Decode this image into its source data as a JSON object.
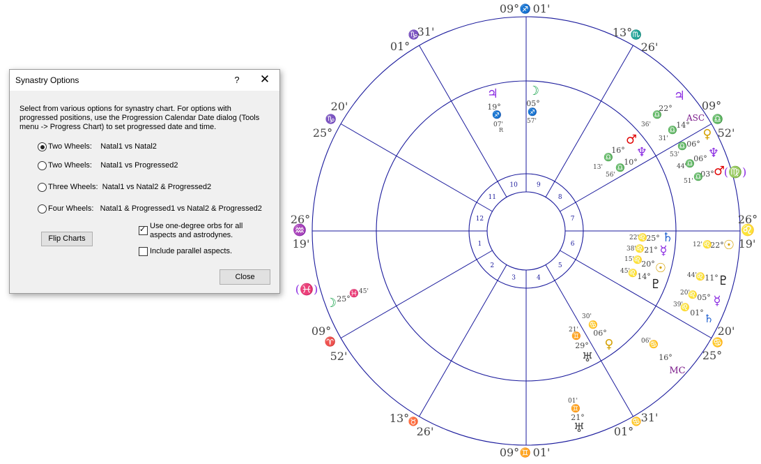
{
  "dialog": {
    "title": "Synastry Options",
    "help_label": "?",
    "close_glyph": "✕",
    "description": "Select from various options for synastry chart. For options with progressed positions, use the Progression Calendar Date dialog (Tools menu -> Progress Chart) to set progressed date and time.",
    "options": [
      {
        "label": "Two Wheels:    Natal1 vs Natal2",
        "selected": true
      },
      {
        "label": "Two Wheels:    Natal1 vs Progressed2",
        "selected": false
      },
      {
        "label": "Three Wheels:  Natal1 vs Natal2 & Progressed2",
        "selected": false
      },
      {
        "label": "Four Wheels:   Natal1 & Progressed1 vs Natal2 & Progressed2",
        "selected": false
      }
    ],
    "flip_label": "Flip Charts",
    "orbs_label": "Use one-degree orbs for all aspects and astrodynes.",
    "orbs_checked": true,
    "parallel_label": "Include parallel aspects.",
    "parallel_checked": false,
    "close_label": "Close"
  },
  "wheel": {
    "colors": {
      "lines": "#1a1a9c",
      "gray": "#444444",
      "purple": "#8a2be2",
      "gold": "#d4a000",
      "red": "#e00000",
      "green": "#16a34a",
      "blue": "#2060d0",
      "black": "#111111",
      "plum": "#7a1a8a"
    },
    "house_numbers": [
      "1",
      "2",
      "3",
      "4",
      "5",
      "6",
      "7",
      "8",
      "9",
      "10",
      "11",
      "12"
    ],
    "cusp_labels": [
      {
        "deg": "26°",
        "sign": "♒",
        "min": "19'",
        "sign_color": "blue"
      },
      {
        "deg": "09°",
        "sign": "♈",
        "min": "52'",
        "sign_color": "red"
      },
      {
        "deg": "13°",
        "sign": "♉",
        "min": "26'",
        "sign_color": "gold"
      },
      {
        "deg": "09°",
        "sign": "♊",
        "min": "01'",
        "sign_color": "purple"
      },
      {
        "deg": "01°",
        "sign": "♋",
        "min": "31'",
        "sign_color": "green"
      },
      {
        "deg": "20'",
        "sign": "♋",
        "min": "25°",
        "sign_color": "green"
      },
      {
        "deg": "26°",
        "sign": "♌",
        "min": "19'",
        "sign_color": "gold"
      },
      {
        "deg": "(♍)",
        "sign": "",
        "min": "",
        "sign_color": "purple"
      },
      {
        "deg": "09°",
        "sign": "♎",
        "min": "52'",
        "sign_color": "gold"
      },
      {
        "deg": "13°",
        "sign": "♏",
        "min": "26'",
        "sign_color": "red"
      },
      {
        "deg": "09°",
        "sign": "♐",
        "min": "01'",
        "sign_color": "purple"
      },
      {
        "deg": "01°",
        "sign": "♑",
        "min": "31'",
        "sign_color": "blue"
      },
      {
        "deg": "20'",
        "sign": "♑",
        "min": "25°",
        "sign_color": "blue"
      },
      {
        "deg": "(♓)",
        "sign": "",
        "min": "",
        "sign_color": "purple"
      }
    ],
    "glyphs": [
      {
        "g": "♃",
        "c": "purple",
        "n": "jupiter-icon"
      },
      {
        "g": "19°",
        "c": "gray",
        "n": "degree"
      },
      {
        "g": "♐",
        "c": "purple",
        "n": "sagittarius-icon"
      },
      {
        "g": "07'",
        "c": "gray",
        "n": "minute"
      },
      {
        "g": "R",
        "c": "gray",
        "n": "retro-mark"
      },
      {
        "g": "☽",
        "c": "green",
        "n": "moon-icon"
      },
      {
        "g": "05°",
        "c": "gray",
        "n": "degree"
      },
      {
        "g": "♐",
        "c": "purple",
        "n": "sagittarius-icon"
      },
      {
        "g": "57'",
        "c": "gray",
        "n": "minute"
      },
      {
        "g": "♃",
        "c": "purple",
        "n": "jupiter-icon"
      },
      {
        "g": "22°",
        "c": "gray",
        "n": "degree"
      },
      {
        "g": "♎",
        "c": "gold",
        "n": "libra-icon"
      },
      {
        "g": "36'",
        "c": "gray",
        "n": "minute"
      },
      {
        "g": "ASC",
        "c": "plum",
        "n": "asc-label"
      },
      {
        "g": "14°",
        "c": "gray",
        "n": "degree"
      },
      {
        "g": "♎",
        "c": "gold",
        "n": "libra-icon"
      },
      {
        "g": "31'",
        "c": "gray",
        "n": "minute"
      },
      {
        "g": "♀",
        "c": "gold",
        "n": "venus-icon"
      },
      {
        "g": "♂",
        "c": "red",
        "n": "mars-icon"
      },
      {
        "g": "16°",
        "c": "gray",
        "n": "degree"
      },
      {
        "g": "♎",
        "c": "gold",
        "n": "libra-icon"
      },
      {
        "g": "13'",
        "c": "gray",
        "n": "minute"
      },
      {
        "g": "♆",
        "c": "purple",
        "n": "neptune-icon"
      },
      {
        "g": "10°",
        "c": "gray",
        "n": "degree"
      },
      {
        "g": "♎",
        "c": "gold",
        "n": "libra-icon"
      },
      {
        "g": "56'",
        "c": "gray",
        "n": "minute"
      },
      {
        "g": "06°",
        "c": "gray",
        "n": "degree"
      },
      {
        "g": "♎",
        "c": "gold",
        "n": "libra-icon"
      },
      {
        "g": "53'",
        "c": "gray",
        "n": "minute"
      },
      {
        "g": "♆",
        "c": "purple",
        "n": "neptune-icon"
      },
      {
        "g": "06°",
        "c": "gray",
        "n": "degree"
      },
      {
        "g": "♎",
        "c": "gold",
        "n": "libra-icon"
      },
      {
        "g": "44'",
        "c": "gray",
        "n": "minute"
      },
      {
        "g": "♂",
        "c": "red",
        "n": "mars-icon"
      },
      {
        "g": "03°",
        "c": "gray",
        "n": "degree"
      },
      {
        "g": "♎",
        "c": "gold",
        "n": "libra-icon"
      },
      {
        "g": "51'",
        "c": "gray",
        "n": "minute"
      },
      {
        "g": "22'",
        "c": "gray",
        "n": "minute"
      },
      {
        "g": "♌",
        "c": "gold",
        "n": "leo-icon"
      },
      {
        "g": "25°",
        "c": "gray",
        "n": "degree"
      },
      {
        "g": "♄",
        "c": "blue",
        "n": "saturn-icon"
      },
      {
        "g": "38'",
        "c": "gray",
        "n": "minute"
      },
      {
        "g": "♌",
        "c": "gold",
        "n": "leo-icon"
      },
      {
        "g": "21°",
        "c": "gray",
        "n": "degree"
      },
      {
        "g": "☿",
        "c": "purple",
        "n": "mercury-icon"
      },
      {
        "g": "15'",
        "c": "gray",
        "n": "minute"
      },
      {
        "g": "♌",
        "c": "gold",
        "n": "leo-icon"
      },
      {
        "g": "20°",
        "c": "gray",
        "n": "degree"
      },
      {
        "g": "☉",
        "c": "gold",
        "n": "sun-icon"
      },
      {
        "g": "45'",
        "c": "gray",
        "n": "minute"
      },
      {
        "g": "♌",
        "c": "gold",
        "n": "leo-icon"
      },
      {
        "g": "14°",
        "c": "gray",
        "n": "degree"
      },
      {
        "g": "♇",
        "c": "black",
        "n": "pluto-icon"
      },
      {
        "g": "12'",
        "c": "gray",
        "n": "minute"
      },
      {
        "g": "♌",
        "c": "gold",
        "n": "leo-icon"
      },
      {
        "g": "22°",
        "c": "gray",
        "n": "degree"
      },
      {
        "g": "☉",
        "c": "gold",
        "n": "sun-icon"
      },
      {
        "g": "44'",
        "c": "gray",
        "n": "minute"
      },
      {
        "g": "♌",
        "c": "gold",
        "n": "leo-icon"
      },
      {
        "g": "11°",
        "c": "gray",
        "n": "degree"
      },
      {
        "g": "♇",
        "c": "black",
        "n": "pluto-icon"
      },
      {
        "g": "20'",
        "c": "gray",
        "n": "minute"
      },
      {
        "g": "♌",
        "c": "gold",
        "n": "leo-icon"
      },
      {
        "g": "05°",
        "c": "gray",
        "n": "degree"
      },
      {
        "g": "☿",
        "c": "purple",
        "n": "mercury-icon"
      },
      {
        "g": "39'",
        "c": "gray",
        "n": "minute"
      },
      {
        "g": "♌",
        "c": "gold",
        "n": "leo-icon"
      },
      {
        "g": "01°",
        "c": "gray",
        "n": "degree"
      },
      {
        "g": "♄",
        "c": "blue",
        "n": "saturn-icon"
      },
      {
        "g": "06'",
        "c": "gray",
        "n": "minute"
      },
      {
        "g": "♋",
        "c": "green",
        "n": "cancer-icon"
      },
      {
        "g": "16°",
        "c": "gray",
        "n": "degree"
      },
      {
        "g": "MC",
        "c": "plum",
        "n": "mc-label"
      },
      {
        "g": "30'",
        "c": "gray",
        "n": "minute"
      },
      {
        "g": "♋",
        "c": "green",
        "n": "cancer-icon"
      },
      {
        "g": "06°",
        "c": "gray",
        "n": "degree"
      },
      {
        "g": "♀",
        "c": "gold",
        "n": "venus-icon"
      },
      {
        "g": "21'",
        "c": "gray",
        "n": "minute"
      },
      {
        "g": "♊",
        "c": "purple",
        "n": "gemini-icon"
      },
      {
        "g": "29°",
        "c": "gray",
        "n": "degree"
      },
      {
        "g": "♅",
        "c": "gray",
        "n": "uranus-icon"
      },
      {
        "g": "01'",
        "c": "gray",
        "n": "minute"
      },
      {
        "g": "♊",
        "c": "purple",
        "n": "gemini-icon"
      },
      {
        "g": "21°",
        "c": "gray",
        "n": "degree"
      },
      {
        "g": "♅",
        "c": "gray",
        "n": "uranus-icon"
      },
      {
        "g": "☽",
        "c": "green",
        "n": "moon-icon"
      },
      {
        "g": "25°",
        "c": "gray",
        "n": "degree"
      },
      {
        "g": "♓",
        "c": "purple",
        "n": "pisces-icon"
      },
      {
        "g": "45'",
        "c": "gray",
        "n": "minute"
      }
    ]
  }
}
